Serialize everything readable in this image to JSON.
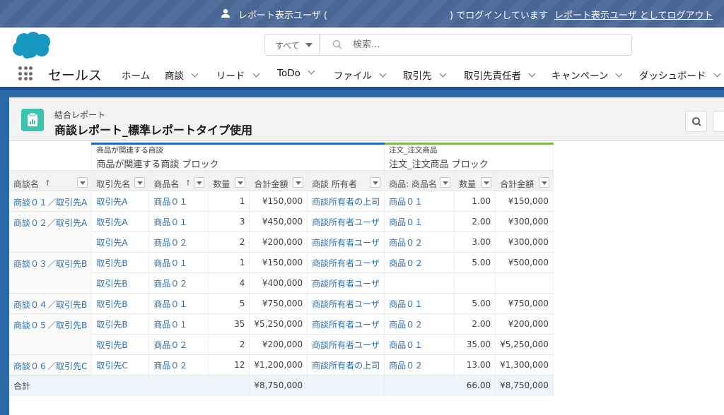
{
  "login_bar": {
    "text_before": "レポート表示ユーザ (",
    "text_after": ") でログインしています",
    "logout_link": "レポート表示ユーザ としてログアウト"
  },
  "header": {
    "search_scope": "すべて",
    "search_placeholder": "検索...",
    "app_name": "セールス",
    "nav": [
      {
        "label": "ホーム",
        "has_menu": false
      },
      {
        "label": "商談",
        "has_menu": true
      },
      {
        "label": "リード",
        "has_menu": true
      },
      {
        "label": "ToDo",
        "has_menu": true
      },
      {
        "label": "ファイル",
        "has_menu": true
      },
      {
        "label": "取引先",
        "has_menu": true
      },
      {
        "label": "取引先責任者",
        "has_menu": true
      },
      {
        "label": "キャンペーン",
        "has_menu": true
      },
      {
        "label": "ダッシュボード",
        "has_menu": true
      }
    ]
  },
  "report": {
    "type": "結合レポート",
    "title": "商談レポート_標準レポートタイプ使用",
    "blocks": [
      {
        "sub": "商品が関連する商談",
        "name": "商品が関連する商談 ブロック",
        "color": "#1f6bc4"
      },
      {
        "sub": "注文_注文商品",
        "name": "注文_注文商品 ブロック",
        "color": "#7bbf4a"
      }
    ],
    "columns": [
      {
        "label": "商談名",
        "sorted": "asc"
      },
      {
        "label": "取引先名",
        "sorted": ""
      },
      {
        "label": "商品名",
        "sorted": "asc"
      },
      {
        "label": "数量",
        "sorted": ""
      },
      {
        "label": "合計金額",
        "sorted": ""
      },
      {
        "label": "商談 所有者",
        "sorted": ""
      },
      {
        "label": "商品: 商品名",
        "sorted": ""
      },
      {
        "label": "数量",
        "sorted": ""
      },
      {
        "label": "合計金額",
        "sorted": ""
      }
    ],
    "sort_arrow": "↑",
    "groups": [
      {
        "deal": "商談０１／取引先A",
        "rows": [
          {
            "account": "取引先A",
            "product": "商品０１",
            "qty": "1",
            "amount": "¥150,000",
            "owner": "商談所有者の上司",
            "o_product": "商品０１",
            "o_qty": "1.00",
            "o_amount": "¥150,000"
          }
        ]
      },
      {
        "deal": "商談０２／取引先A",
        "rows": [
          {
            "account": "取引先A",
            "product": "商品０１",
            "qty": "3",
            "amount": "¥450,000",
            "owner": "商談所有者ユーザ",
            "o_product": "商品０１",
            "o_qty": "2.00",
            "o_amount": "¥300,000"
          },
          {
            "account": "取引先A",
            "product": "商品０２",
            "qty": "2",
            "amount": "¥200,000",
            "owner": "商談所有者ユーザ",
            "o_product": "商品０２",
            "o_qty": "3.00",
            "o_amount": "¥300,000"
          }
        ]
      },
      {
        "deal": "商談０３／取引先B",
        "rows": [
          {
            "account": "取引先B",
            "product": "商品０１",
            "qty": "1",
            "amount": "¥150,000",
            "owner": "商談所有者ユーザ",
            "o_product": "商品０２",
            "o_qty": "5.00",
            "o_amount": "¥500,000"
          },
          {
            "account": "取引先B",
            "product": "商品０２",
            "qty": "4",
            "amount": "¥400,000",
            "owner": "商談所有者ユーザ",
            "o_product": "",
            "o_qty": "",
            "o_amount": ""
          }
        ]
      },
      {
        "deal": "商談０４／取引先B",
        "rows": [
          {
            "account": "取引先B",
            "product": "商品０１",
            "qty": "5",
            "amount": "¥750,000",
            "owner": "商談所有者ユーザ",
            "o_product": "商品０１",
            "o_qty": "5.00",
            "o_amount": "¥750,000"
          }
        ]
      },
      {
        "deal": "商談０５／取引先B",
        "rows": [
          {
            "account": "取引先B",
            "product": "商品０１",
            "qty": "35",
            "amount": "¥5,250,000",
            "owner": "商談所有者ユーザ",
            "o_product": "商品０２",
            "o_qty": "2.00",
            "o_amount": "¥200,000"
          },
          {
            "account": "取引先B",
            "product": "商品０２",
            "qty": "2",
            "amount": "¥200,000",
            "owner": "商談所有者ユーザ",
            "o_product": "商品０１",
            "o_qty": "35.00",
            "o_amount": "¥5,250,000"
          }
        ]
      },
      {
        "deal": "商談０６／取引先C",
        "rows": [
          {
            "account": "取引先C",
            "product": "商品０２",
            "qty": "12",
            "amount": "¥1,200,000",
            "owner": "商談所有者の上司",
            "o_product": "商品０２",
            "o_qty": "13.00",
            "o_amount": "¥1,300,000"
          }
        ]
      }
    ],
    "total": {
      "label": "合計",
      "amount": "¥8,750,000",
      "o_qty": "66.00",
      "o_amount": "¥8,750,000"
    }
  }
}
